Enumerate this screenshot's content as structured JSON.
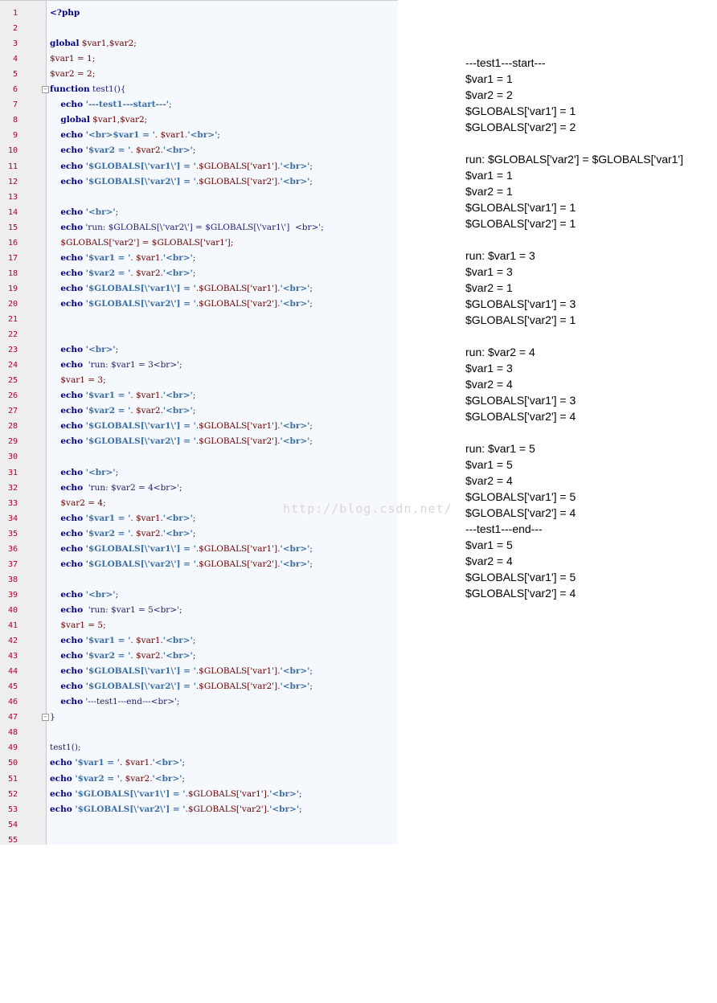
{
  "editor": {
    "lines": [
      {
        "n": "1",
        "tokens": [
          {
            "t": "<?php",
            "c": "kw"
          }
        ]
      },
      {
        "n": "2",
        "tokens": []
      },
      {
        "n": "3",
        "tokens": [
          {
            "t": "global",
            "c": "kw"
          },
          {
            "t": " $var1,$var2;",
            "c": "var"
          }
        ]
      },
      {
        "n": "4",
        "tokens": [
          {
            "t": "$var1 = 1;",
            "c": "var"
          }
        ]
      },
      {
        "n": "5",
        "tokens": [
          {
            "t": "$var2 = 2;",
            "c": "var"
          }
        ]
      },
      {
        "n": "6",
        "fold": true,
        "tokens": [
          {
            "t": "function",
            "c": "kw"
          },
          {
            "t": " test1(){",
            "c": "plain"
          }
        ]
      },
      {
        "n": "7",
        "tokens": [
          {
            "t": "    "
          },
          {
            "t": "echo",
            "c": "kw"
          },
          {
            "t": " '---test1---start---'",
            "c": "str"
          },
          {
            "t": ";",
            "c": "plain"
          }
        ]
      },
      {
        "n": "8",
        "tokens": [
          {
            "t": "    "
          },
          {
            "t": "global",
            "c": "kw"
          },
          {
            "t": " $var1,$var2;",
            "c": "var"
          }
        ]
      },
      {
        "n": "9",
        "tokens": [
          {
            "t": "    "
          },
          {
            "t": "echo",
            "c": "kw"
          },
          {
            "t": " '<br>",
            "c": "str"
          },
          {
            "t": "$var1 = '",
            "c": "str"
          },
          {
            "t": ". $var1.",
            "c": "var"
          },
          {
            "t": "'<br>'",
            "c": "str"
          },
          {
            "t": ";",
            "c": "plain"
          }
        ]
      },
      {
        "n": "10",
        "tokens": [
          {
            "t": "    "
          },
          {
            "t": "echo",
            "c": "kw"
          },
          {
            "t": " '$var2 = '",
            "c": "str"
          },
          {
            "t": ". $var2.",
            "c": "var"
          },
          {
            "t": "'<br>'",
            "c": "str"
          },
          {
            "t": ";",
            "c": "plain"
          }
        ]
      },
      {
        "n": "11",
        "tokens": [
          {
            "t": "    "
          },
          {
            "t": "echo",
            "c": "kw"
          },
          {
            "t": " '$GLOBALS[\\'var1\\'] = '",
            "c": "str"
          },
          {
            "t": ".$GLOBALS['var1'].",
            "c": "var"
          },
          {
            "t": "'<br>'",
            "c": "str"
          },
          {
            "t": ";",
            "c": "plain"
          }
        ]
      },
      {
        "n": "12",
        "tokens": [
          {
            "t": "    "
          },
          {
            "t": "echo",
            "c": "kw"
          },
          {
            "t": " '$GLOBALS[\\'var2\\'] = '",
            "c": "str"
          },
          {
            "t": ".$GLOBALS['var2'].",
            "c": "var"
          },
          {
            "t": "'<br>'",
            "c": "str"
          },
          {
            "t": ";",
            "c": "plain"
          }
        ]
      },
      {
        "n": "13",
        "tokens": []
      },
      {
        "n": "14",
        "tokens": [
          {
            "t": "    "
          },
          {
            "t": "echo",
            "c": "kw"
          },
          {
            "t": " '<br>'",
            "c": "str"
          },
          {
            "t": ";",
            "c": "plain"
          }
        ]
      },
      {
        "n": "15",
        "tokens": [
          {
            "t": "    "
          },
          {
            "t": "echo",
            "c": "kw"
          },
          {
            "t": " 'run: $GLOBALS[\\'var2\\'] = $GLOBALS[\\'var1\\']  <br>'",
            "c": "plain"
          },
          {
            "t": ";",
            "c": "plain"
          }
        ]
      },
      {
        "n": "16",
        "tokens": [
          {
            "t": "    "
          },
          {
            "t": "$GLOBALS['var2'] = $GLOBALS['var1'];",
            "c": "var"
          }
        ]
      },
      {
        "n": "17",
        "tokens": [
          {
            "t": "    "
          },
          {
            "t": "echo",
            "c": "kw"
          },
          {
            "t": " '$var1 = '",
            "c": "str"
          },
          {
            "t": ". $var1.",
            "c": "var"
          },
          {
            "t": "'<br>'",
            "c": "str"
          },
          {
            "t": ";",
            "c": "plain"
          }
        ]
      },
      {
        "n": "18",
        "tokens": [
          {
            "t": "    "
          },
          {
            "t": "echo",
            "c": "kw"
          },
          {
            "t": " '$var2 = '",
            "c": "str"
          },
          {
            "t": ". $var2.",
            "c": "var"
          },
          {
            "t": "'<br>'",
            "c": "str"
          },
          {
            "t": ";",
            "c": "plain"
          }
        ]
      },
      {
        "n": "19",
        "tokens": [
          {
            "t": "    "
          },
          {
            "t": "echo",
            "c": "kw"
          },
          {
            "t": " '$GLOBALS[\\'var1\\'] = '",
            "c": "str"
          },
          {
            "t": ".$GLOBALS['var1'].",
            "c": "var"
          },
          {
            "t": "'<br>'",
            "c": "str"
          },
          {
            "t": ";",
            "c": "plain"
          }
        ]
      },
      {
        "n": "20",
        "tokens": [
          {
            "t": "    "
          },
          {
            "t": "echo",
            "c": "kw"
          },
          {
            "t": " '$GLOBALS[\\'var2\\'] = '",
            "c": "str"
          },
          {
            "t": ".$GLOBALS['var2'].",
            "c": "var"
          },
          {
            "t": "'<br>'",
            "c": "str"
          },
          {
            "t": ";",
            "c": "plain"
          }
        ]
      },
      {
        "n": "21",
        "tokens": []
      },
      {
        "n": "22",
        "tokens": []
      },
      {
        "n": "23",
        "tokens": [
          {
            "t": "    "
          },
          {
            "t": "echo",
            "c": "kw"
          },
          {
            "t": " '<br>'",
            "c": "str"
          },
          {
            "t": ";",
            "c": "plain"
          }
        ]
      },
      {
        "n": "24",
        "tokens": [
          {
            "t": "    "
          },
          {
            "t": "echo",
            "c": "kw"
          },
          {
            "t": "  'run: $var1 = 3<br>'",
            "c": "plain"
          },
          {
            "t": ";",
            "c": "plain"
          }
        ]
      },
      {
        "n": "25",
        "tokens": [
          {
            "t": "    "
          },
          {
            "t": "$var1 = 3;",
            "c": "var"
          }
        ]
      },
      {
        "n": "26",
        "tokens": [
          {
            "t": "    "
          },
          {
            "t": "echo",
            "c": "kw"
          },
          {
            "t": " '$var1 = '",
            "c": "str"
          },
          {
            "t": ". $var1.",
            "c": "var"
          },
          {
            "t": "'<br>'",
            "c": "str"
          },
          {
            "t": ";",
            "c": "plain"
          }
        ]
      },
      {
        "n": "27",
        "tokens": [
          {
            "t": "    "
          },
          {
            "t": "echo",
            "c": "kw"
          },
          {
            "t": " '$var2 = '",
            "c": "str"
          },
          {
            "t": ". $var2.",
            "c": "var"
          },
          {
            "t": "'<br>'",
            "c": "str"
          },
          {
            "t": ";",
            "c": "plain"
          }
        ]
      },
      {
        "n": "28",
        "tokens": [
          {
            "t": "    "
          },
          {
            "t": "echo",
            "c": "kw"
          },
          {
            "t": " '$GLOBALS[\\'var1\\'] = '",
            "c": "str"
          },
          {
            "t": ".$GLOBALS['var1'].",
            "c": "var"
          },
          {
            "t": "'<br>'",
            "c": "str"
          },
          {
            "t": ";",
            "c": "plain"
          }
        ]
      },
      {
        "n": "29",
        "tokens": [
          {
            "t": "    "
          },
          {
            "t": "echo",
            "c": "kw"
          },
          {
            "t": " '$GLOBALS[\\'var2\\'] = '",
            "c": "str"
          },
          {
            "t": ".$GLOBALS['var2'].",
            "c": "var"
          },
          {
            "t": "'<br>'",
            "c": "str"
          },
          {
            "t": ";",
            "c": "plain"
          }
        ]
      },
      {
        "n": "30",
        "tokens": []
      },
      {
        "n": "31",
        "tokens": [
          {
            "t": "    "
          },
          {
            "t": "echo",
            "c": "kw"
          },
          {
            "t": " '<br>'",
            "c": "str"
          },
          {
            "t": ";",
            "c": "plain"
          }
        ]
      },
      {
        "n": "32",
        "tokens": [
          {
            "t": "    "
          },
          {
            "t": "echo",
            "c": "kw"
          },
          {
            "t": "  'run: $var2 = 4<br>'",
            "c": "plain"
          },
          {
            "t": ";",
            "c": "plain"
          }
        ]
      },
      {
        "n": "33",
        "tokens": [
          {
            "t": "    "
          },
          {
            "t": "$var2 = 4;",
            "c": "var"
          }
        ]
      },
      {
        "n": "34",
        "tokens": [
          {
            "t": "    "
          },
          {
            "t": "echo",
            "c": "kw"
          },
          {
            "t": " '$var1 = '",
            "c": "str"
          },
          {
            "t": ". $var1.",
            "c": "var"
          },
          {
            "t": "'<br>'",
            "c": "str"
          },
          {
            "t": ";",
            "c": "plain"
          }
        ]
      },
      {
        "n": "35",
        "tokens": [
          {
            "t": "    "
          },
          {
            "t": "echo",
            "c": "kw"
          },
          {
            "t": " '$var2 = '",
            "c": "str"
          },
          {
            "t": ". $var2.",
            "c": "var"
          },
          {
            "t": "'<br>'",
            "c": "str"
          },
          {
            "t": ";",
            "c": "plain"
          }
        ]
      },
      {
        "n": "36",
        "tokens": [
          {
            "t": "    "
          },
          {
            "t": "echo",
            "c": "kw"
          },
          {
            "t": " '$GLOBALS[\\'var1\\'] = '",
            "c": "str"
          },
          {
            "t": ".$GLOBALS['var1'].",
            "c": "var"
          },
          {
            "t": "'<br>'",
            "c": "str"
          },
          {
            "t": ";",
            "c": "plain"
          }
        ]
      },
      {
        "n": "37",
        "tokens": [
          {
            "t": "    "
          },
          {
            "t": "echo",
            "c": "kw"
          },
          {
            "t": " '$GLOBALS[\\'var2\\'] = '",
            "c": "str"
          },
          {
            "t": ".$GLOBALS['var2'].",
            "c": "var"
          },
          {
            "t": "'<br>'",
            "c": "str"
          },
          {
            "t": ";",
            "c": "plain"
          }
        ]
      },
      {
        "n": "38",
        "tokens": []
      },
      {
        "n": "39",
        "tokens": [
          {
            "t": "    "
          },
          {
            "t": "echo",
            "c": "kw"
          },
          {
            "t": " '<br>'",
            "c": "str"
          },
          {
            "t": ";",
            "c": "plain"
          }
        ]
      },
      {
        "n": "40",
        "tokens": [
          {
            "t": "    "
          },
          {
            "t": "echo",
            "c": "kw"
          },
          {
            "t": "  'run: $var1 = 5<br>'",
            "c": "plain"
          },
          {
            "t": ";",
            "c": "plain"
          }
        ]
      },
      {
        "n": "41",
        "tokens": [
          {
            "t": "    "
          },
          {
            "t": "$var1 = 5;",
            "c": "var"
          }
        ]
      },
      {
        "n": "42",
        "tokens": [
          {
            "t": "    "
          },
          {
            "t": "echo",
            "c": "kw"
          },
          {
            "t": " '$var1 = '",
            "c": "str"
          },
          {
            "t": ". $var1.",
            "c": "var"
          },
          {
            "t": "'<br>'",
            "c": "str"
          },
          {
            "t": ";",
            "c": "plain"
          }
        ]
      },
      {
        "n": "43",
        "tokens": [
          {
            "t": "    "
          },
          {
            "t": "echo",
            "c": "kw"
          },
          {
            "t": " '$var2 = '",
            "c": "str"
          },
          {
            "t": ". $var2.",
            "c": "var"
          },
          {
            "t": "'<br>'",
            "c": "str"
          },
          {
            "t": ";",
            "c": "plain"
          }
        ]
      },
      {
        "n": "44",
        "tokens": [
          {
            "t": "    "
          },
          {
            "t": "echo",
            "c": "kw"
          },
          {
            "t": " '$GLOBALS[\\'var1\\'] = '",
            "c": "str"
          },
          {
            "t": ".$GLOBALS['var1'].",
            "c": "var"
          },
          {
            "t": "'<br>'",
            "c": "str"
          },
          {
            "t": ";",
            "c": "plain"
          }
        ]
      },
      {
        "n": "45",
        "tokens": [
          {
            "t": "    "
          },
          {
            "t": "echo",
            "c": "kw"
          },
          {
            "t": " '$GLOBALS[\\'var2\\'] = '",
            "c": "str"
          },
          {
            "t": ".$GLOBALS['var2'].",
            "c": "var"
          },
          {
            "t": "'<br>'",
            "c": "str"
          },
          {
            "t": ";",
            "c": "plain"
          }
        ]
      },
      {
        "n": "46",
        "tokens": [
          {
            "t": "    "
          },
          {
            "t": "echo",
            "c": "kw"
          },
          {
            "t": " '---test1---end---<br>'",
            "c": "plain"
          },
          {
            "t": ";",
            "c": "plain"
          }
        ]
      },
      {
        "n": "47",
        "fold": true,
        "tokens": [
          {
            "t": "}",
            "c": "plain"
          }
        ]
      },
      {
        "n": "48",
        "tokens": []
      },
      {
        "n": "49",
        "tokens": [
          {
            "t": "test1();",
            "c": "plain"
          }
        ]
      },
      {
        "n": "50",
        "tokens": [
          {
            "t": "echo",
            "c": "kw"
          },
          {
            "t": " '$var1 = '",
            "c": "str"
          },
          {
            "t": ". $var1.",
            "c": "var"
          },
          {
            "t": "'<br>'",
            "c": "str"
          },
          {
            "t": ";",
            "c": "plain"
          }
        ]
      },
      {
        "n": "51",
        "tokens": [
          {
            "t": "echo",
            "c": "kw"
          },
          {
            "t": " '$var2 = '",
            "c": "str"
          },
          {
            "t": ". $var2.",
            "c": "var"
          },
          {
            "t": "'<br>'",
            "c": "str"
          },
          {
            "t": ";",
            "c": "plain"
          }
        ]
      },
      {
        "n": "52",
        "tokens": [
          {
            "t": "echo",
            "c": "kw"
          },
          {
            "t": " '$GLOBALS[\\'var1\\'] = '",
            "c": "str"
          },
          {
            "t": ".$GLOBALS['var1'].",
            "c": "var"
          },
          {
            "t": "'<br>'",
            "c": "str"
          },
          {
            "t": ";",
            "c": "plain"
          }
        ]
      },
      {
        "n": "53",
        "tokens": [
          {
            "t": "echo",
            "c": "kw"
          },
          {
            "t": " '$GLOBALS[\\'var2\\'] = '",
            "c": "str"
          },
          {
            "t": ".$GLOBALS['var2'].",
            "c": "var"
          },
          {
            "t": "'<br>'",
            "c": "str"
          },
          {
            "t": ";",
            "c": "plain"
          }
        ]
      },
      {
        "n": "54",
        "tokens": []
      },
      {
        "n": "55",
        "tokens": []
      }
    ]
  },
  "output": {
    "lines": [
      "---test1---start---",
      "$var1 = 1",
      "$var2 = 2",
      "$GLOBALS['var1'] = 1",
      "$GLOBALS['var2'] = 2",
      "",
      "run: $GLOBALS['var2'] = $GLOBALS['var1']",
      "$var1 = 1",
      "$var2 = 1",
      "$GLOBALS['var1'] = 1",
      "$GLOBALS['var2'] = 1",
      "",
      "run: $var1 = 3",
      "$var1 = 3",
      "$var2 = 1",
      "$GLOBALS['var1'] = 3",
      "$GLOBALS['var2'] = 1",
      "",
      "run: $var2 = 4",
      "$var1 = 3",
      "$var2 = 4",
      "$GLOBALS['var1'] = 3",
      "$GLOBALS['var2'] = 4",
      "",
      "run: $var1 = 5",
      "$var1 = 5",
      "$var2 = 4",
      "$GLOBALS['var1'] = 5",
      "$GLOBALS['var2'] = 4",
      "---test1---end---",
      "$var1 = 5",
      "$var2 = 4",
      "$GLOBALS['var1'] = 5",
      "$GLOBALS['var2'] = 4"
    ]
  },
  "watermark": "http://blog.csdn.net/"
}
